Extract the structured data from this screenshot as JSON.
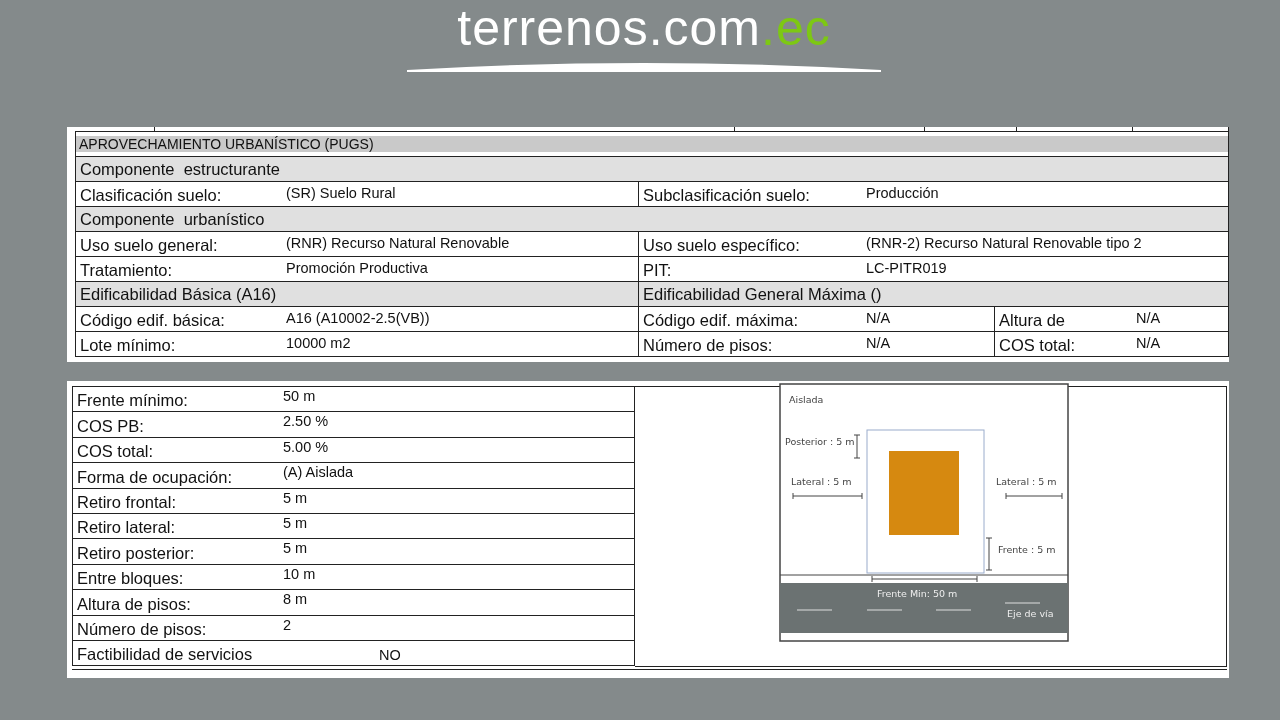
{
  "logo": {
    "name": "terrenos.com",
    "suffix": ".ec"
  },
  "sheet_1": {
    "title": "APROVECHAMIENTO URBANÍSTICO (PUGS)",
    "rows": [
      {
        "kind": "header",
        "text": "Componente  estructurante"
      },
      {
        "kind": "pair",
        "cells": [
          {
            "label": "Clasificación suelo:",
            "value": "(SR) Suelo Rural"
          },
          {
            "label": "Subclasificación suelo:",
            "value": "Producción"
          }
        ]
      },
      {
        "kind": "header",
        "text": "Componente  urbanístico"
      },
      {
        "kind": "pair",
        "cells": [
          {
            "label": "Uso suelo general:",
            "value": "(RNR) Recurso Natural Renovable"
          },
          {
            "label": "Uso suelo específico:",
            "value": "(RNR-2) Recurso Natural Renovable tipo 2"
          }
        ]
      },
      {
        "kind": "pair",
        "cells": [
          {
            "label": "Tratamiento:",
            "value": "Promoción Productiva"
          },
          {
            "label": "PIT:",
            "value": "LC-PITR019"
          }
        ]
      },
      {
        "kind": "split_header",
        "texts": [
          "Edificabilidad Básica (A16)",
          "Edificabilidad General Máxima ()"
        ]
      },
      {
        "kind": "triple",
        "cells": [
          {
            "label": "Código edif. básica:",
            "value": "A16 (A10002-2.5(VB))"
          },
          {
            "label": "Código edif. máxima:",
            "value": "N/A"
          },
          {
            "label": "Altura de",
            "value": "N/A"
          }
        ]
      },
      {
        "kind": "triple",
        "cells": [
          {
            "label": "Lote mínimo:",
            "value": "10000 m2"
          },
          {
            "label": "Número de pisos:",
            "value": "N/A"
          },
          {
            "label": "COS total:",
            "value": "N/A"
          }
        ]
      }
    ]
  },
  "sheet_2": {
    "rows": [
      {
        "label": "Frente mínimo:",
        "value": "50 m"
      },
      {
        "label": "COS PB:",
        "value": "2.50 %"
      },
      {
        "label": "COS total:",
        "value": "5.00 %"
      },
      {
        "label": "Forma de ocupación:",
        "value": "(A) Aislada"
      },
      {
        "label": "Retiro frontal:",
        "value": "5 m"
      },
      {
        "label": "Retiro lateral:",
        "value": "5 m"
      },
      {
        "label": "Retiro posterior:",
        "value": "5 m"
      },
      {
        "label": "Entre bloques:",
        "value": "10 m"
      },
      {
        "label": "Altura de pisos:",
        "value": "8 m"
      },
      {
        "label": "Número de pisos:",
        "value": "2"
      },
      {
        "label": "Factibilidad de servicios",
        "value": "NO"
      }
    ],
    "diagram": {
      "title": "Aislada",
      "posterior": "Posterior : 5 m",
      "lateral_left": "Lateral : 5 m",
      "lateral_right": "Lateral : 5 m",
      "frente": "Frente : 5 m",
      "frente_min": "Frente Min: 50 m",
      "axis": "Eje de vía"
    }
  }
}
